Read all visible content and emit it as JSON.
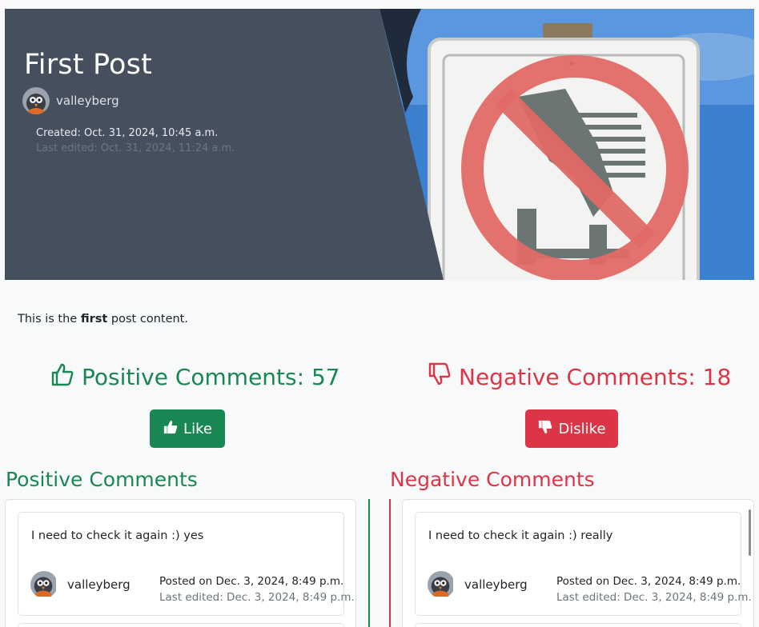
{
  "post": {
    "title": "First Post",
    "author": "valleyberg",
    "created": "Created: Oct. 31, 2024, 10:45 a.m.",
    "last_edited": "Last edited: Oct. 31, 2024, 11:24 a.m.",
    "content_before": "This is the ",
    "content_bold": "first",
    "content_after": " post content."
  },
  "counts": {
    "positive_label": "Positive Comments: 57",
    "negative_label": "Negative Comments: 18"
  },
  "buttons": {
    "like": "Like",
    "dislike": "Dislike"
  },
  "sections": {
    "positive_title": "Positive Comments",
    "negative_title": "Negative Comments"
  },
  "comments": {
    "positive": [
      {
        "text": "I need to check it again :) yes",
        "author": "valleyberg",
        "posted_prefix": "Posted on",
        "posted_date": "Dec. 3, 2024, 8:49 p.m.",
        "edited": "Last edited: Dec. 3, 2024, 8:49 p.m."
      }
    ],
    "negative": [
      {
        "text": "I need to check it again :) really",
        "author": "valleyberg",
        "posted_prefix": "Posted on",
        "posted_date": "Dec. 3, 2024, 8:49 p.m.",
        "edited": "Last edited: Dec. 3, 2024, 8:49 p.m."
      }
    ]
  },
  "colors": {
    "positive": "#198754",
    "negative": "#dc3545",
    "hero_bg": "#454f5d"
  },
  "icons": {
    "positive": "thumbs-up-icon",
    "negative": "thumbs-down-icon",
    "hero_image": "no-sitting-sign-image"
  }
}
